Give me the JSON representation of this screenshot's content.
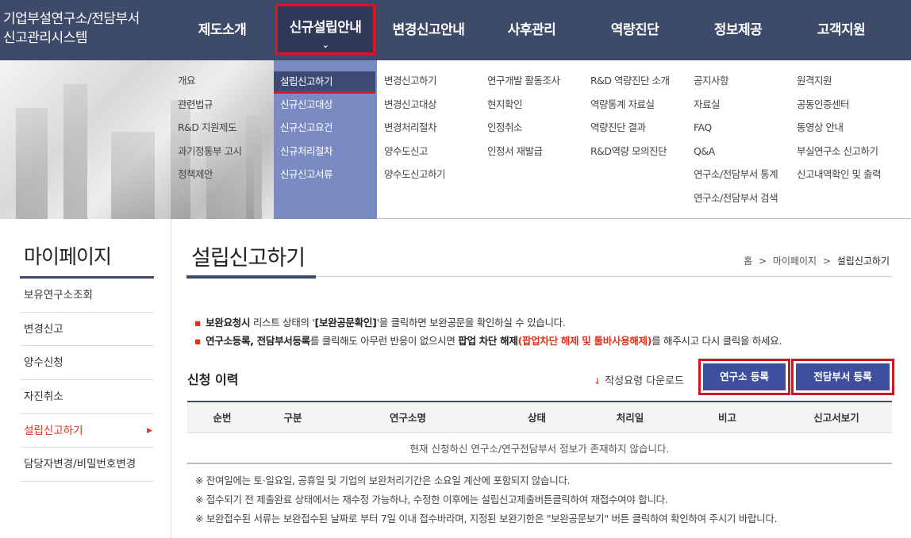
{
  "header": {
    "logo_line1": "기업부설연구소/전담부서",
    "logo_line2": "신고관리시스템",
    "nav": [
      {
        "label": "제도소개"
      },
      {
        "label": "신규설립안내",
        "chevron": "⌄"
      },
      {
        "label": "변경신고안내"
      },
      {
        "label": "사후관리"
      },
      {
        "label": "역량진단"
      },
      {
        "label": "정보제공"
      },
      {
        "label": "고객지원"
      }
    ]
  },
  "mega_menu": {
    "columns": [
      [
        "개요",
        "관련법규",
        "R&D 지원제도",
        "과기정통부 고시",
        "정책제안"
      ],
      [
        "설립신고하기",
        "신규신고대상",
        "신규신고요건",
        "신규처리절차",
        "신규신고서류"
      ],
      [
        "변경신고하기",
        "변경신고대상",
        "변경처리절차",
        "양수도신고",
        "양수도신고하기"
      ],
      [
        "연구개발 활동조사",
        "현지확인",
        "인정취소",
        "인정서 재발급"
      ],
      [
        "R&D 역량진단 소개",
        "역량통계 자료실",
        "역량진단 결과",
        "R&D역량 모의진단"
      ],
      [
        "공지사항",
        "자료실",
        "FAQ",
        "Q&A",
        "연구소/전담부서 통계",
        "연구소/전담부서 검색"
      ],
      [
        "원격지원",
        "공동인증센터",
        "동영상 안내",
        "부실연구소 신고하기",
        "신고내역확인 및 출력"
      ]
    ]
  },
  "sidebar": {
    "title": "마이페이지",
    "items": [
      {
        "label": "보유연구소조회"
      },
      {
        "label": "변경신고"
      },
      {
        "label": "양수신청"
      },
      {
        "label": "자진취소"
      },
      {
        "label": "설립신고하기",
        "arrow": "▶"
      },
      {
        "label": "담당자변경/비밀번호변경"
      }
    ]
  },
  "main": {
    "title": "설립신고하기",
    "breadcrumb": [
      "홈",
      "마이페이지",
      "설립신고하기"
    ],
    "breadcrumb_sep": ">",
    "notice1": {
      "bold1": "보완요청시",
      "text1": " 리스트 상태의 '",
      "bold2": "[보완공문확인]",
      "text2": "'을 클릭하면 보완공문을 확인하실 수 있습니다."
    },
    "notice2": {
      "bold1": "연구소등록, 전담부서등록",
      "text1": "를 클릭해도 아무런 반응이 없으시면 ",
      "bold2": "팝업 차단 해제",
      "red": "(팝업차단 해제 및 툴바사용해제)",
      "text2": "를 해주시고 다시 클릭을 하세요."
    },
    "section_title": "신청 이력",
    "download_label": "작성요령 다운로드",
    "download_icon": "↓",
    "btn_lab": "연구소 등록",
    "btn_dept": "전담부서 등록",
    "table": {
      "headers": [
        "순번",
        "구분",
        "연구소명",
        "상태",
        "처리일",
        "비고",
        "신고서보기"
      ],
      "empty": "현재 신청하신 연구소/연구전담부서 정보가 존재하지 않습니다."
    },
    "notes": [
      "※ 잔여일에는 토·일요일, 공휴일 및 기업의 보완처리기간은 소요일 계산에 포함되지 않습니다.",
      "※ 접수되기 전 제출완료 상태에서는 재수정 가능하나, 수정한 이후에는 설립신고제출버튼클릭하여 재접수여야 합니다.",
      "※ 보완접수된 서류는 보완접수된 날짜로 부터 7일 이내 접수바라며, 지정된 보완기한은 \"보완공문보기\" 버튼 클릭하여 확인하여 주시기 바랍니다."
    ]
  },
  "colors": {
    "header_bg": "#3e4a6a",
    "accent_red": "#e0141e",
    "button_blue": "#3e4fa0",
    "menu_active_bg": "#7a8ac2"
  }
}
